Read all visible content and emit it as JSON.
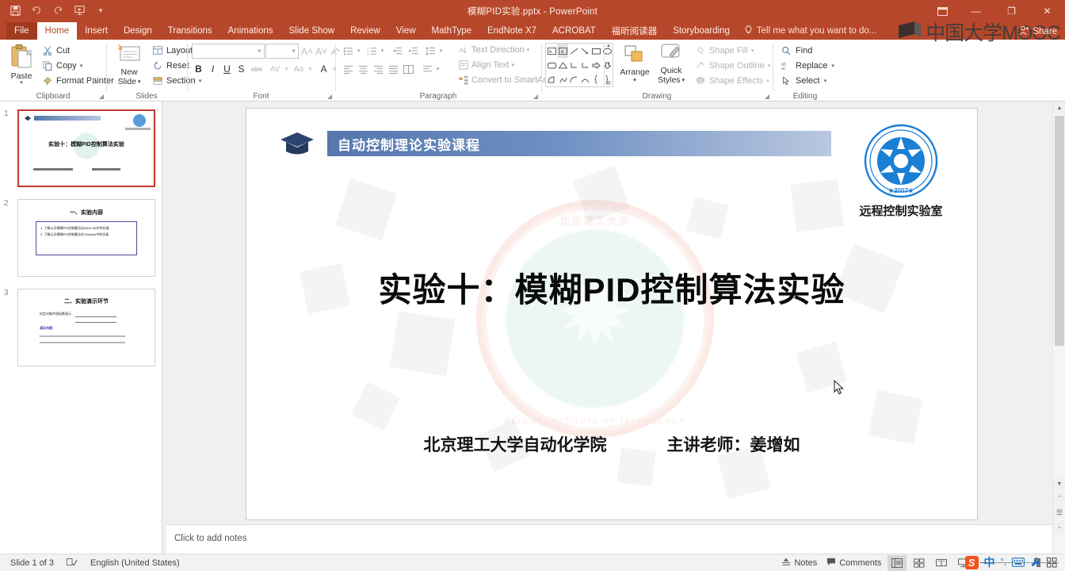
{
  "window": {
    "title": "模糊PID实验.pptx - PowerPoint",
    "quick_access": [
      {
        "name": "save-icon",
        "label": "Save"
      },
      {
        "name": "undo-icon",
        "label": "Undo"
      },
      {
        "name": "redo-icon",
        "label": "Redo"
      },
      {
        "name": "start-from-beginning-icon",
        "label": "Start From Beginning"
      },
      {
        "name": "customize-quick-access-icon",
        "label": "Customize Quick Access Toolbar"
      }
    ],
    "controls": {
      "ribbon_display": "⊡",
      "minimize": "—",
      "restore": "❐",
      "close": "✕"
    }
  },
  "tabs": [
    {
      "label": "File",
      "active": false,
      "file": true
    },
    {
      "label": "Home",
      "active": true
    },
    {
      "label": "Insert",
      "active": false
    },
    {
      "label": "Design",
      "active": false
    },
    {
      "label": "Transitions",
      "active": false
    },
    {
      "label": "Animations",
      "active": false
    },
    {
      "label": "Slide Show",
      "active": false
    },
    {
      "label": "Review",
      "active": false
    },
    {
      "label": "View",
      "active": false
    },
    {
      "label": "MathType",
      "active": false
    },
    {
      "label": "EndNote X7",
      "active": false
    },
    {
      "label": "ACROBAT",
      "active": false
    },
    {
      "label": "福昕阅读器",
      "active": false
    },
    {
      "label": "Storyboarding",
      "active": false
    }
  ],
  "tell_me": {
    "placeholder": "Tell me what you want to do...",
    "icon": "lightbulb-icon"
  },
  "share": {
    "label": "Share",
    "icon": "share-person-icon"
  },
  "ribbon": {
    "clipboard": {
      "group_label": "Clipboard",
      "paste_label": "Paste",
      "items": [
        {
          "label": "Cut",
          "icon": "scissors-icon"
        },
        {
          "label": "Copy",
          "icon": "copy-icon",
          "has_arrow": true
        },
        {
          "label": "Format Painter",
          "icon": "format-painter-icon"
        }
      ]
    },
    "slides": {
      "group_label": "Slides",
      "new_slide_line1": "New",
      "new_slide_line2": "Slide",
      "items": [
        {
          "label": "Layout",
          "icon": "layout-icon",
          "has_arrow": true
        },
        {
          "label": "Reset",
          "icon": "reset-icon"
        },
        {
          "label": "Section",
          "icon": "section-icon",
          "has_arrow": true
        }
      ]
    },
    "font": {
      "group_label": "Font",
      "font_name_value": "",
      "font_size_value": "",
      "buttons": [
        {
          "name": "increase-font-size-icon",
          "glyph": "A˄"
        },
        {
          "name": "decrease-font-size-icon",
          "glyph": "A˅"
        },
        {
          "name": "clear-formatting-icon",
          "glyph": "A"
        },
        {
          "name": "bold-icon",
          "glyph": "B"
        },
        {
          "name": "italic-icon",
          "glyph": "I"
        },
        {
          "name": "underline-icon",
          "glyph": "U"
        },
        {
          "name": "text-shadow-icon",
          "glyph": "S"
        },
        {
          "name": "strikethrough-icon",
          "glyph": "abc"
        },
        {
          "name": "character-spacing-icon",
          "glyph": "AV"
        },
        {
          "name": "change-case-icon",
          "glyph": "Aa"
        },
        {
          "name": "font-color-icon",
          "glyph": "A"
        }
      ]
    },
    "paragraph": {
      "group_label": "Paragraph",
      "text_items": [
        {
          "label": "Text Direction",
          "icon": "text-direction-icon"
        },
        {
          "label": "Align Text",
          "icon": "align-text-icon"
        },
        {
          "label": "Convert to SmartArt",
          "icon": "smartart-icon"
        }
      ]
    },
    "drawing": {
      "group_label": "Drawing",
      "arrange_label": "Arrange",
      "quick_styles_line1": "Quick",
      "quick_styles_line2": "Styles",
      "items": [
        {
          "label": "Shape Fill",
          "icon": "shape-fill-icon"
        },
        {
          "label": "Shape Outline",
          "icon": "shape-outline-icon"
        },
        {
          "label": "Shape Effects",
          "icon": "shape-effects-icon"
        }
      ]
    },
    "editing": {
      "group_label": "Editing",
      "items": [
        {
          "label": "Find",
          "icon": "search-icon"
        },
        {
          "label": "Replace",
          "icon": "replace-icon",
          "has_arrow": true
        },
        {
          "label": "Select",
          "icon": "select-arrow-icon",
          "has_arrow": true
        }
      ]
    }
  },
  "thumbnails": [
    {
      "number": "1",
      "selected": true,
      "title": "实验十：模糊PID控制算法实验"
    },
    {
      "number": "2",
      "selected": false,
      "title": "一、实验内容",
      "lines": [
        "1. 了解认识模糊PID控制算法在MATLAB中的仿真",
        "2. 了解认识模糊PID控制算法在Simulink中的仿真"
      ]
    },
    {
      "number": "3",
      "selected": false,
      "title": "二、实验演示环节",
      "lines": [
        "给定对象传递函数演示",
        "演示内容："
      ]
    }
  ],
  "slide": {
    "header_band": "自动控制理论实验课程",
    "header_icon": "graduation-cap-icon",
    "lab_logo_icon": "remote-lab-emblem-icon",
    "lab_logo_year": "2007",
    "lab_caption": "远程控制实验室",
    "main_title": "实验十：模糊PID控制算法实验",
    "footer_left": "北京理工大学自动化学院",
    "footer_right": "主讲老师：姜增如",
    "watermark_top": "北京理工大学",
    "watermark_bottom": "BEIJING INSTITUTE OF TECHNOLOGY"
  },
  "notes": {
    "placeholder": "Click to add notes"
  },
  "status": {
    "slide_counter": "Slide 1 of 3",
    "spellcheck_icon": "spellcheck-icon",
    "language": "English (United States)",
    "notes_label": "Notes",
    "notes_icon": "notes-icon",
    "comments_label": "Comments",
    "comments_icon": "comments-icon",
    "views": [
      {
        "name": "normal-view-icon",
        "active": true
      },
      {
        "name": "slide-sorter-view-icon",
        "active": false
      },
      {
        "name": "reading-view-icon",
        "active": false
      },
      {
        "name": "slide-show-view-icon",
        "active": false
      }
    ],
    "zoom_out": "−",
    "zoom_in": "+",
    "fit_slide_icon": "fit-to-window-icon"
  },
  "overlays": {
    "mooc_watermark": "中国大学MOOC",
    "mooc_icon": "mooc-logo-icon",
    "ime": {
      "logo": "S",
      "mode": "中",
      "punctuation": "°,",
      "keyboard_icon": "keyboard-icon",
      "toolbox_icon": "wrench-icon"
    }
  },
  "colors": {
    "accent": "#b7472a",
    "band_blue": "#5577ad",
    "selection": "#c0392b"
  }
}
